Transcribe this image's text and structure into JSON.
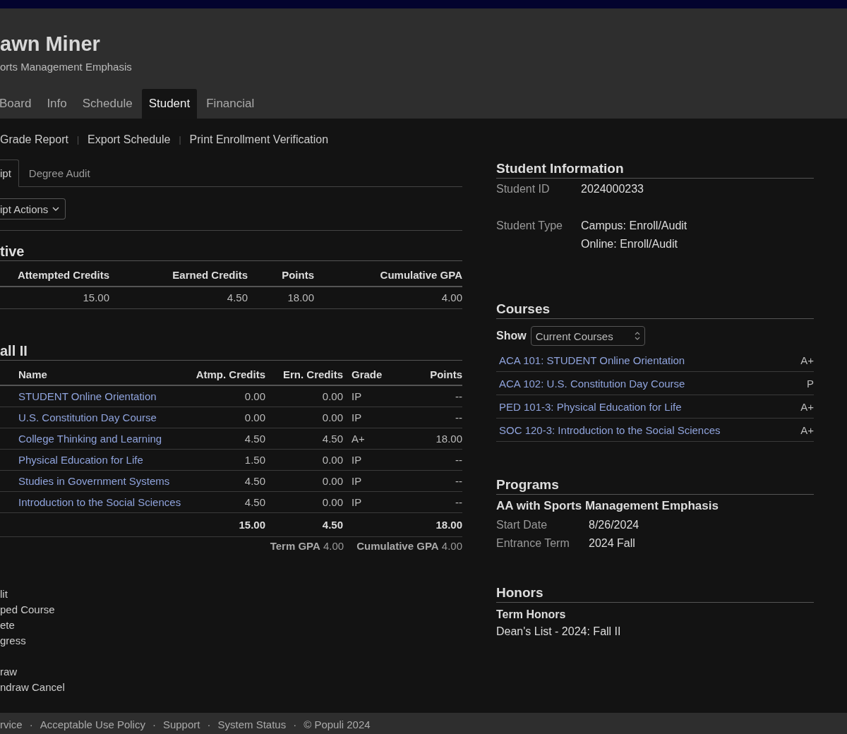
{
  "header": {
    "name": "awn Miner",
    "subtitle": "orts Management Emphasis",
    "tabs": [
      {
        "label": "Board",
        "selected": false
      },
      {
        "label": "Info",
        "selected": false
      },
      {
        "label": "Schedule",
        "selected": false
      },
      {
        "label": "Student",
        "selected": true
      },
      {
        "label": "Financial",
        "selected": false
      }
    ]
  },
  "actions": {
    "separator": "|",
    "links": [
      "Grade Report",
      "Export Schedule",
      "Print Enrollment Verification"
    ]
  },
  "subtabs": [
    {
      "label": "ipt",
      "selected": true
    },
    {
      "label": "Degree Audit",
      "selected": false
    }
  ],
  "menu_button": "ipt Actions",
  "cumulative": {
    "title": "tive",
    "columns": [
      "Attempted Credits",
      "Earned Credits",
      "Points",
      "Cumulative GPA"
    ],
    "row": [
      "15.00",
      "4.50",
      "18.00",
      "4.00"
    ]
  },
  "term": {
    "title": "all II",
    "columns": [
      "Name",
      "Atmp. Credits",
      "Ern. Credits",
      "Grade",
      "Points"
    ],
    "rows": [
      {
        "name": "STUDENT Online Orientation",
        "atmp": "0.00",
        "ern": "0.00",
        "grade": "IP",
        "points": "--"
      },
      {
        "name": "U.S. Constitution Day Course",
        "atmp": "0.00",
        "ern": "0.00",
        "grade": "IP",
        "points": "--"
      },
      {
        "name": "College Thinking and Learning",
        "atmp": "4.50",
        "ern": "4.50",
        "grade": "A+",
        "points": "18.00"
      },
      {
        "name": "Physical Education for Life",
        "atmp": "1.50",
        "ern": "0.00",
        "grade": "IP",
        "points": "--"
      },
      {
        "name": "Studies in Government Systems",
        "atmp": "4.50",
        "ern": "0.00",
        "grade": "IP",
        "points": "--"
      },
      {
        "name": "Introduction to the Social Sciences",
        "atmp": "4.50",
        "ern": "0.00",
        "grade": "IP",
        "points": "--"
      }
    ],
    "totals": {
      "atmp": "15.00",
      "ern": "4.50",
      "points": "18.00"
    },
    "term_gpa_label": "Term GPA",
    "term_gpa": "4.00",
    "cum_gpa_label": "Cumulative GPA",
    "cum_gpa": "4.00"
  },
  "legend": [
    [
      "lit",
      "ped Course",
      "ete",
      "gress"
    ],
    [
      "raw",
      "ndraw Cancel"
    ]
  ],
  "student_information": {
    "title": "Student Information",
    "fields": [
      {
        "label": "Student ID",
        "values": [
          "2024000233"
        ]
      },
      {
        "label": "Student Type",
        "values": [
          "Campus: Enroll/Audit",
          "Online: Enroll/Audit"
        ]
      }
    ]
  },
  "courses": {
    "title": "Courses",
    "show_label": "Show",
    "show_value": "Current Courses",
    "items": [
      {
        "name": "ACA 101: STUDENT Online Orientation",
        "grade": "A+"
      },
      {
        "name": "ACA 102: U.S. Constitution Day Course",
        "grade": "P"
      },
      {
        "name": "PED 101-3: Physical Education for Life",
        "grade": "A+"
      },
      {
        "name": "SOC 120-3: Introduction to the Social Sciences",
        "grade": "A+"
      }
    ]
  },
  "programs": {
    "title": "Programs",
    "program": "AA with Sports Management Emphasis",
    "fields": [
      {
        "label": "Start Date",
        "value": "8/26/2024"
      },
      {
        "label": "Entrance Term",
        "value": "2024 Fall"
      }
    ]
  },
  "honors": {
    "title": "Honors",
    "subtitle": "Term Honors",
    "items": [
      "Dean's List - 2024: Fall II"
    ]
  },
  "footer": {
    "separator": "·",
    "links": [
      "rvice",
      "Acceptable Use Policy",
      "Support",
      "System Status"
    ],
    "copyright": "© Populi 2024"
  }
}
